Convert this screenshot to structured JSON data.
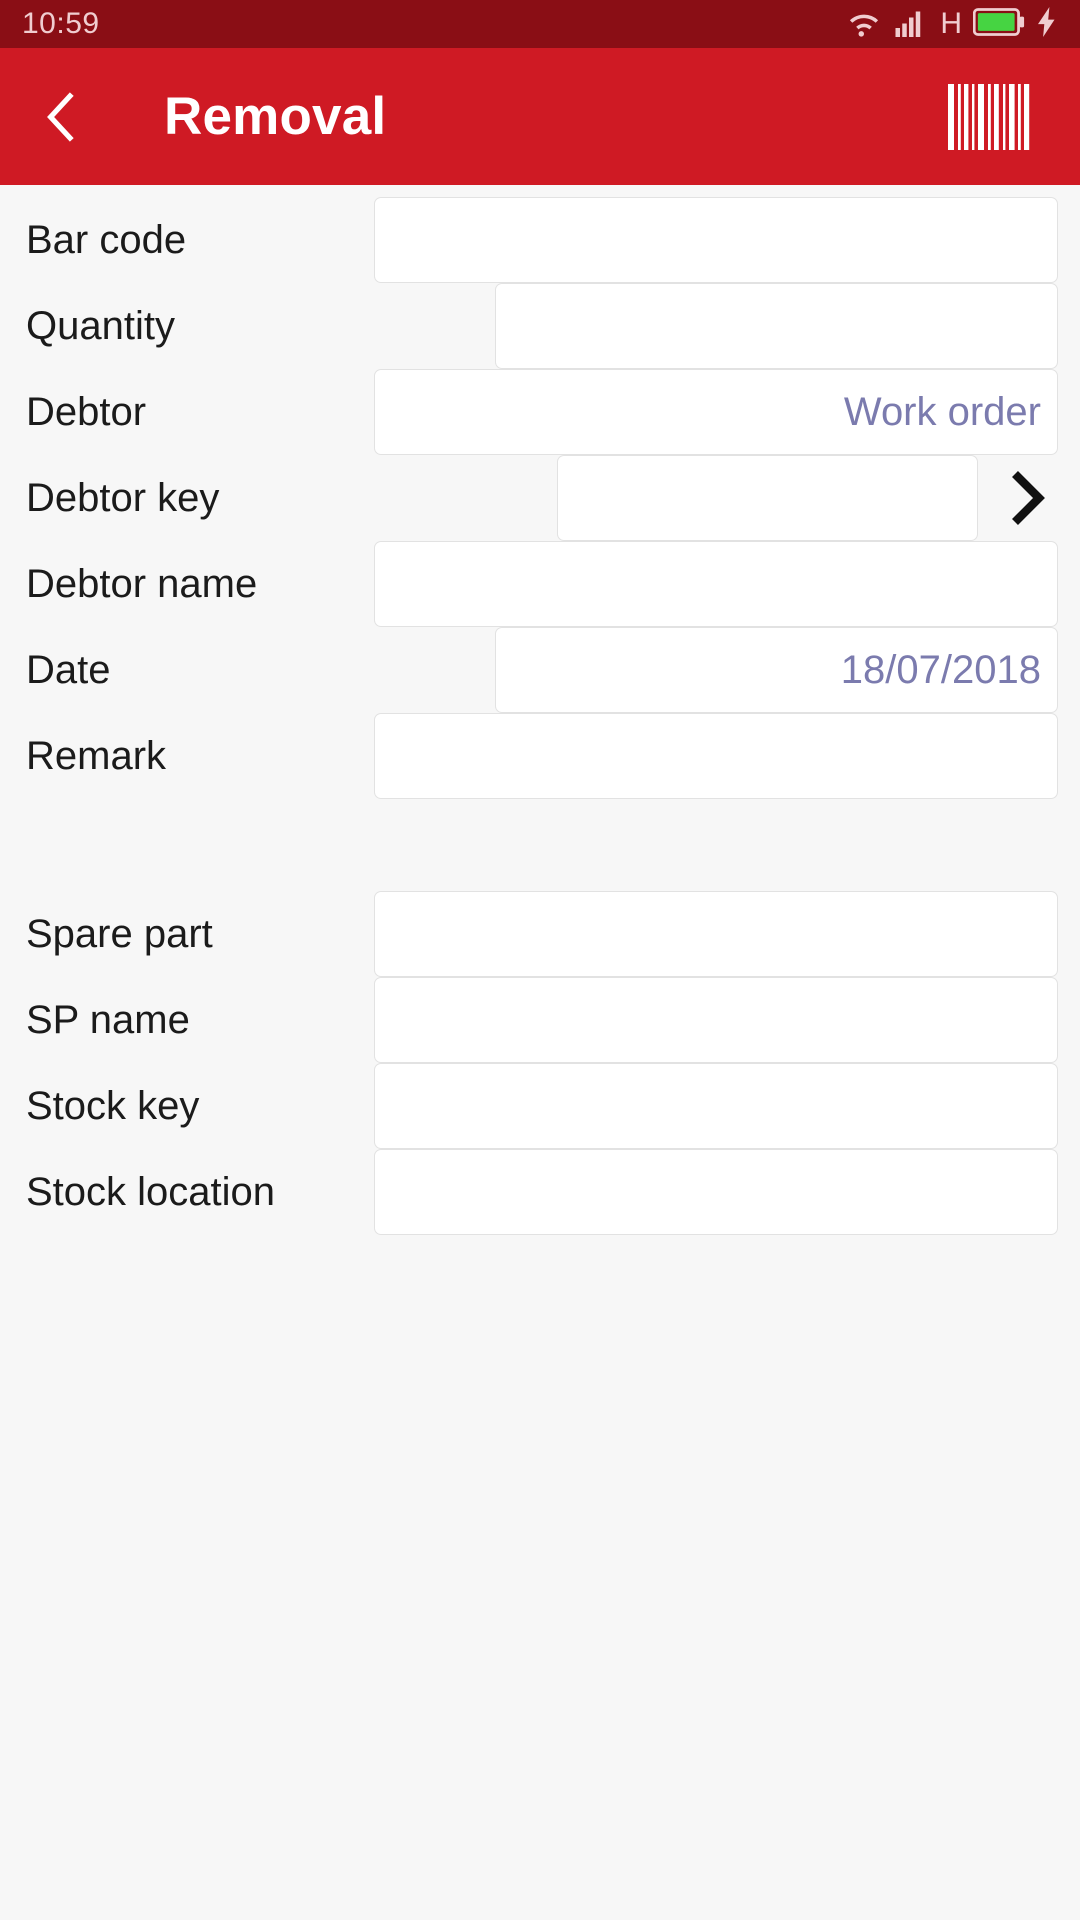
{
  "statusbar": {
    "time": "10:59",
    "icons": [
      {
        "name": "wifi-icon",
        "label": "wifi"
      },
      {
        "name": "cellular-signal-icon",
        "label": "signal"
      },
      {
        "name": "network-type-label",
        "label": "H"
      },
      {
        "name": "battery-icon",
        "label": "battery"
      },
      {
        "name": "charging-bolt-icon",
        "label": "charging"
      }
    ],
    "battery_color": "#46d442"
  },
  "appbar": {
    "title": "Removal",
    "back_icon": "arrow-left-icon",
    "barcode_icon": "barcode-scan-icon",
    "background": "#cf1a24"
  },
  "form": {
    "groups": [
      {
        "rows": [
          {
            "label": "Bar code",
            "value": "",
            "width": "full",
            "chevron": false
          },
          {
            "label": "Quantity",
            "value": "",
            "width": "narrow-1",
            "chevron": false
          },
          {
            "label": "Debtor",
            "value": "Work order",
            "width": "full",
            "chevron": false
          },
          {
            "label": "Debtor key",
            "value": "",
            "width": "narrow-2",
            "chevron": true
          },
          {
            "label": "Debtor name",
            "value": "",
            "width": "full",
            "chevron": false
          },
          {
            "label": "Date",
            "value": "18/07/2018",
            "width": "narrow-1",
            "chevron": false
          },
          {
            "label": "Remark",
            "value": "",
            "width": "full",
            "chevron": false
          }
        ]
      },
      {
        "rows": [
          {
            "label": "Spare part",
            "value": "",
            "width": "full",
            "chevron": false
          },
          {
            "label": "SP name",
            "value": "",
            "width": "full",
            "chevron": false
          },
          {
            "label": "Stock key",
            "value": "",
            "width": "full",
            "chevron": false
          },
          {
            "label": "Stock location",
            "value": "",
            "width": "full",
            "chevron": false
          }
        ]
      }
    ],
    "value_color": "#7b7bae",
    "field_background": "#ffffff",
    "page_background": "#f7f7f7"
  }
}
